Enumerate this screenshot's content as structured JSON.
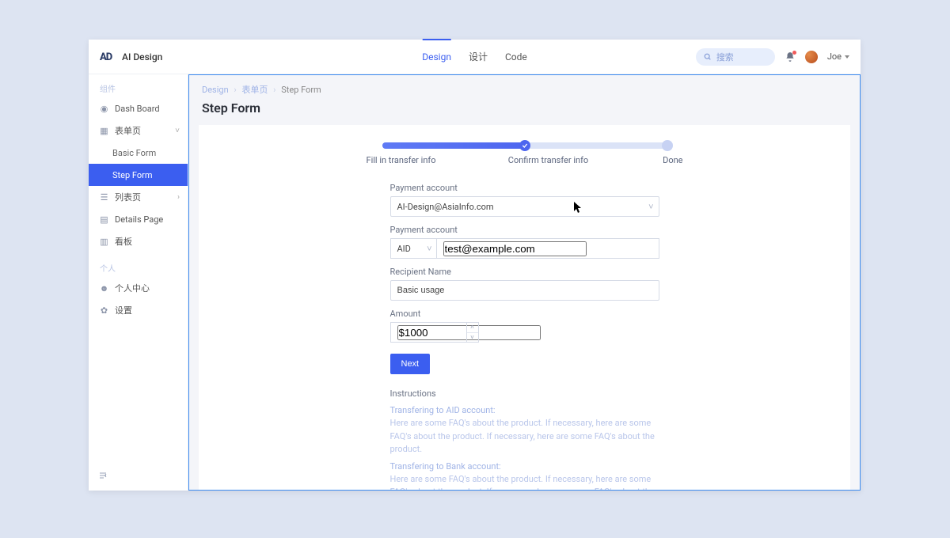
{
  "window_tag": "Step Form",
  "brand": {
    "logo_text": "AD",
    "name": "AI Design"
  },
  "top_tabs": [
    {
      "label": "Design",
      "active": true
    },
    {
      "label": "设计",
      "active": false
    },
    {
      "label": "Code",
      "active": false
    }
  ],
  "search_placeholder": "搜索",
  "user": {
    "name": "Joe"
  },
  "sidebar": {
    "section1_label": "组件",
    "items": [
      {
        "icon": "dashboard",
        "label": "Dash Board"
      },
      {
        "icon": "form",
        "label": "表单页",
        "expandable": true,
        "expanded": true
      },
      {
        "sub": true,
        "label": "Basic Form"
      },
      {
        "sub": true,
        "label": "Step Form",
        "active": true
      },
      {
        "icon": "list",
        "label": "列表页",
        "expandable": true
      },
      {
        "icon": "detail",
        "label": "Details Page"
      },
      {
        "icon": "board",
        "label": "看板"
      }
    ],
    "section2_label": "个人",
    "items2": [
      {
        "icon": "user",
        "label": "个人中心"
      },
      {
        "icon": "gear",
        "label": "设置"
      }
    ]
  },
  "breadcrumb": {
    "a": "Design",
    "b": "表单页",
    "c": "Step Form"
  },
  "page_title": "Step Form",
  "steps": {
    "labels": [
      "Fill in transfer info",
      "Confirm transfer info",
      "Done"
    ],
    "progress_percent": 50
  },
  "form": {
    "payment_account_label": "Payment account",
    "payment_account_value": "AI-Design@AsiaInfo.com",
    "second_account_label": "Payment account",
    "second_account_prefix": "AID",
    "second_account_value": "test@example.com",
    "recipient_label": "Recipient Name",
    "recipient_value": "Basic usage",
    "amount_label": "Amount",
    "amount_value": "$1000",
    "next_button": "Next"
  },
  "instructions": {
    "header": "Instructions",
    "block1_title": "Transfering to AID account:",
    "block1_body": "Here are some FAQ's about the product. If necessary, here are some FAQ's about the product. If necessary, here are some FAQ's about the product.",
    "block2_title": "Transfering to Bank account:",
    "block2_body": "Here are some FAQ's about the product. If necessary, here are some FAQ's about the product. If necessary, here are some FAQ's about the product."
  },
  "colors": {
    "primary": "#3b5ef0"
  }
}
